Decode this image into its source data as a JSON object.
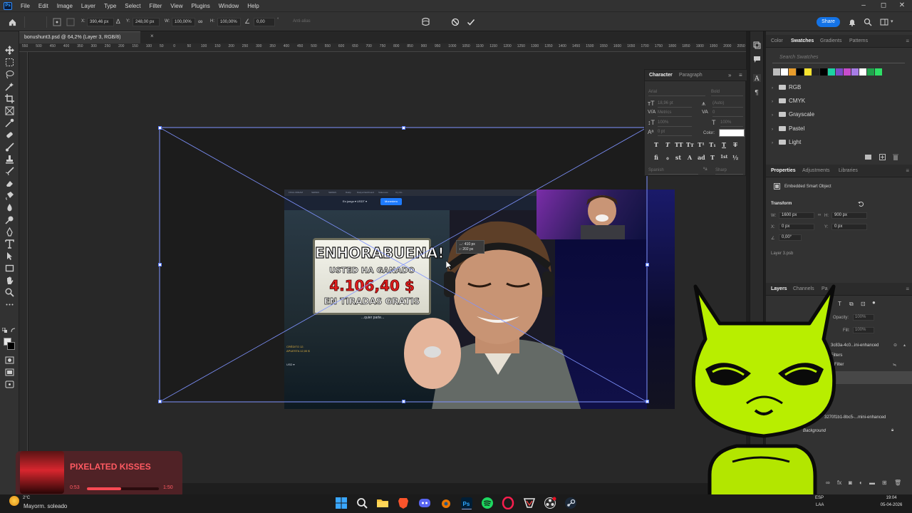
{
  "app": {
    "name": "Adobe Photoshop"
  },
  "menu": [
    "File",
    "Edit",
    "Image",
    "Layer",
    "Type",
    "Select",
    "Filter",
    "View",
    "Plugins",
    "Window",
    "Help"
  ],
  "options": {
    "x_label": "X:",
    "x_value": "390,46 px",
    "y_label": "Y:",
    "y_value": "248,00 px",
    "w_label": "W:",
    "w_value": "100,00%",
    "h_label": "H:",
    "h_value": "100,00%",
    "angle_value": "0,00",
    "antialias": "Anti-alias",
    "share_label": "Share"
  },
  "document": {
    "tab_title": "bonushunt3.psd @ 64,2% (Layer 3, RGB/8)",
    "close": "×"
  },
  "ruler": [
    "550",
    "500",
    "450",
    "400",
    "350",
    "300",
    "250",
    "200",
    "150",
    "100",
    "50",
    "0",
    "50",
    "100",
    "150",
    "200",
    "250",
    "300",
    "350",
    "400",
    "450",
    "500",
    "550",
    "600",
    "650",
    "700",
    "750",
    "800",
    "850",
    "900",
    "950",
    "1000",
    "1050",
    "1100",
    "1150",
    "1200",
    "1250",
    "1300",
    "1350",
    "1400",
    "1450",
    "1500",
    "1550",
    "1600",
    "1650",
    "1700",
    "1750",
    "1800",
    "1850",
    "1900",
    "1950",
    "2000",
    "2050"
  ],
  "canvas_image": {
    "tabs": [
      "FINAL DREAM",
      "SERIES",
      "SERIES",
      "Rakip",
      "Rakya Dashboard",
      "Stakeview",
      "Cry Ro.."
    ],
    "wallet": "En juego ▾ USDT ▾",
    "deposit": "Monedero",
    "win_title": "ENHORABUENA!",
    "win_sub": "USTED HA GANADO",
    "win_amount": "4.106,40 $",
    "win_spins": "EN TIRADAS GRATIS",
    "any_part": "...quier parte...",
    "credit_lines": [
      "CRÉDITO 12.",
      "APUESTA 12,00 $"
    ],
    "usd": "USD ▾"
  },
  "transform_tip": {
    "w": "↔: 410 px",
    "h": "↕: 202 px"
  },
  "character_panel": {
    "tabs": [
      "Character",
      "Paragraph"
    ],
    "font_family": "Arial",
    "font_style": "Bold",
    "size": "18,96 pt",
    "leading": "(Auto)",
    "kerning": "Metrics",
    "tracking": "0",
    "vscale": "100%",
    "hscale": "100%",
    "baseline": "0 pt",
    "color_label": "Color:",
    "language": "Spanish",
    "antialias": "Sharp",
    "style_buttons": [
      "T",
      "T",
      "TT",
      "Tт",
      "T¹",
      "T₁",
      "T",
      "T"
    ],
    "opentype_buttons": [
      "fi",
      "ℴ",
      "st",
      "A",
      "ad",
      "T",
      "1st",
      "½"
    ]
  },
  "swatches_panel": {
    "tabs": [
      "Color",
      "Swatches",
      "Gradients",
      "Patterns"
    ],
    "search_placeholder": "Search Swatches",
    "colors": [
      "#bdbdbd",
      "#ffffff",
      "#e79c2c",
      "#000000",
      "#f5e22f",
      "#222222",
      "#000000",
      "#1dd2a3",
      "#7b4cc9",
      "#c84ccd",
      "#a77de6",
      "#ffffff",
      "#1fa44c",
      "#2ee067"
    ],
    "folders": [
      "RGB",
      "CMYK",
      "Grayscale",
      "Pastel",
      "Light"
    ]
  },
  "properties_panel": {
    "tabs": [
      "Properties",
      "Adjustments",
      "Libraries"
    ],
    "type": "Embedded Smart Object",
    "section": "Transform",
    "w_label": "W:",
    "w_value": "1600 px",
    "h_label": "H:",
    "h_value": "900 px",
    "x_label": "X:",
    "x_value": "0 px",
    "y_label": "Y:",
    "y_value": "0 px",
    "angle_value": "0,00°",
    "file": "Layer 3.psb"
  },
  "layers_panel": {
    "tabs": [
      "Layers",
      "Channels",
      "Pa"
    ],
    "opacity_label": "Opacity:",
    "opacity": "100%",
    "fill_label": "Fill:",
    "fill": "100%",
    "rows": [
      "3c83a-4c0...ini-enhanced",
      "Filters",
      "Filter",
      "3270f1b1-8bc5-...mini-enhanced",
      "Background"
    ]
  },
  "music_widget": {
    "song": "PIXELATED KISSES",
    "time_current": "0:53",
    "time_total": "1:50",
    "progress": 0.48
  },
  "taskbar": {
    "temperature": "2°C",
    "weather": "Mayorm. soleado",
    "lang": "ESP",
    "lang_sub": "LAA",
    "time": "19:04",
    "date": "05-04-2026"
  }
}
